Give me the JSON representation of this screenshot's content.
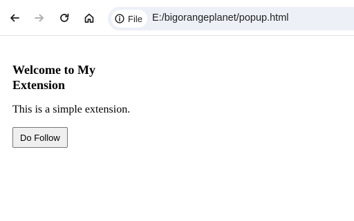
{
  "browser": {
    "nav": {
      "back_icon": "arrow-left-icon",
      "forward_icon": "arrow-right-icon",
      "reload_icon": "reload-icon",
      "home_icon": "home-icon"
    },
    "omnibox": {
      "chip_icon": "info-icon",
      "chip_label": "File",
      "url": "E:/bigorangeplanet/popup.html"
    }
  },
  "page": {
    "heading": "Welcome to My Extension",
    "paragraph": "This is a simple extension.",
    "button_label": "Do Follow"
  },
  "colors": {
    "toolbar_bg": "#ffffff",
    "omnibox_bg": "#edf0f7",
    "icon_color": "#444746",
    "forward_disabled": "#a8a8a8"
  }
}
